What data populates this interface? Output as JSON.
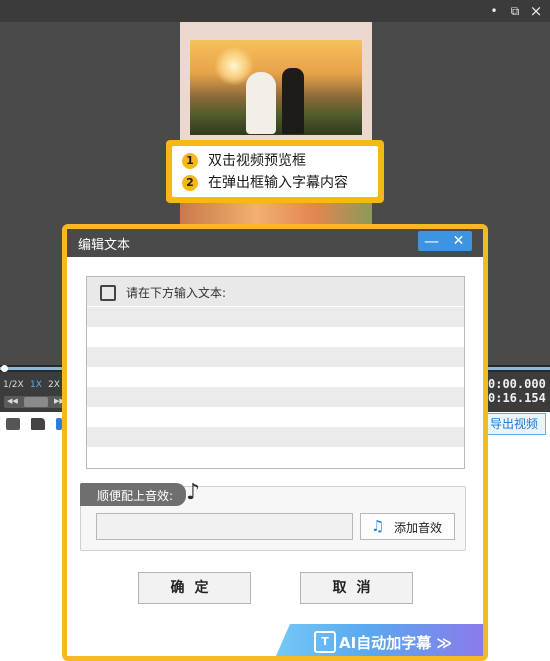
{
  "window": {
    "controls": {
      "minimize_glyph": "•",
      "restore_glyph": "⧉",
      "close_glyph": "×"
    }
  },
  "callout": {
    "steps": [
      {
        "num": "1",
        "text": "双击视频预览框"
      },
      {
        "num": "2",
        "text": "在弹出框输入字幕内容"
      }
    ]
  },
  "player": {
    "speeds": [
      "1/2X",
      "1X",
      "2X"
    ],
    "selected_speed": "1X",
    "current_time": "0:00.000",
    "total_time": "0:16.154",
    "export_label": "导出视频"
  },
  "dialog": {
    "title": "编辑文本",
    "minimize_glyph": "—",
    "close_glyph": "✕",
    "text_area_label": "请在下方输入文本:",
    "text_value": "",
    "sound_section_label": "顺便配上音效:",
    "sound_file_value": "",
    "add_sound_label": "添加音效",
    "ok_label": "确定",
    "cancel_label": "取消",
    "ai_subtitle_label": "AI自动加字幕 ≫"
  },
  "colors": {
    "accent_yellow": "#f6b823",
    "dialog_header": "#4a4a4a",
    "ctrl_blue": "#3d94e0",
    "export_blue": "#2478c8"
  },
  "icons": [
    "minimize-icon",
    "restore-icon",
    "close-icon",
    "edit-icon",
    "music-note-icon",
    "add-sound-icon",
    "ai-subtitle-icon"
  ]
}
